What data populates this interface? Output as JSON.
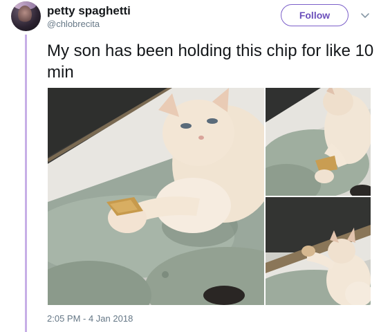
{
  "tweet": {
    "display_name": "petty spaghetti",
    "handle": "@chlobrecita",
    "follow_label": "Follow",
    "text": "My son has been holding this chip for like 10 min",
    "timestamp": "2:05 PM - 4 Jan 2018"
  },
  "media": {
    "photo_count": 3,
    "photos": [
      "cat holding chip on couch",
      "cat holding chip from above",
      "cat reaching with paw"
    ]
  },
  "icons": {
    "more": "chevron-down-icon"
  },
  "colors": {
    "accent": "#7b5fc9",
    "thread_line": "#c7aee6",
    "name": "#14171a",
    "secondary_text": "#657786"
  }
}
